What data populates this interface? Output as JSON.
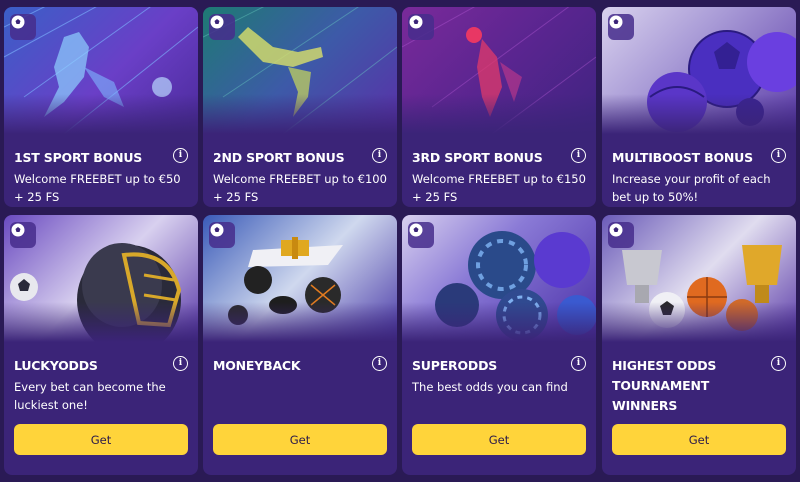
{
  "colors": {
    "background": "#2a1a55",
    "card": "#3b2478",
    "button": "#ffd43a",
    "button_text": "#2b1a4a"
  },
  "cards": [
    {
      "title": "1ST SPORT BONUS",
      "description": "Welcome FREEBET up to €50 + 25 FS",
      "info_icon": "info-icon",
      "badge_icon": "soccer-ball-icon"
    },
    {
      "title": "2ND SPORT BONUS",
      "description": "Welcome FREEBET up to €100 + 25 FS",
      "info_icon": "info-icon",
      "badge_icon": "soccer-ball-icon"
    },
    {
      "title": "3RD SPORT BONUS",
      "description": "Welcome FREEBET up to €150 + 25 FS",
      "info_icon": "info-icon",
      "badge_icon": "soccer-ball-icon"
    },
    {
      "title": "MULTIBOOST BONUS",
      "description": "Increase your profit of each bet up to 50%!",
      "info_icon": "info-icon",
      "badge_icon": "soccer-ball-icon"
    },
    {
      "title": "LUCKYODDS",
      "description": "Every bet can become the luckiest one!",
      "button": "Get",
      "info_icon": "info-icon",
      "badge_icon": "soccer-ball-icon"
    },
    {
      "title": "MONEYBACK",
      "description": "",
      "button": "Get",
      "info_icon": "info-icon",
      "badge_icon": "soccer-ball-icon"
    },
    {
      "title": "SUPERODDS",
      "description": "The best odds you can find",
      "button": "Get",
      "info_icon": "info-icon",
      "badge_icon": "soccer-ball-icon"
    },
    {
      "title": "HIGHEST ODDS TOURNAMENT WINNERS",
      "description": "",
      "button": "Get",
      "info_icon": "info-icon",
      "badge_icon": "soccer-ball-icon"
    }
  ]
}
